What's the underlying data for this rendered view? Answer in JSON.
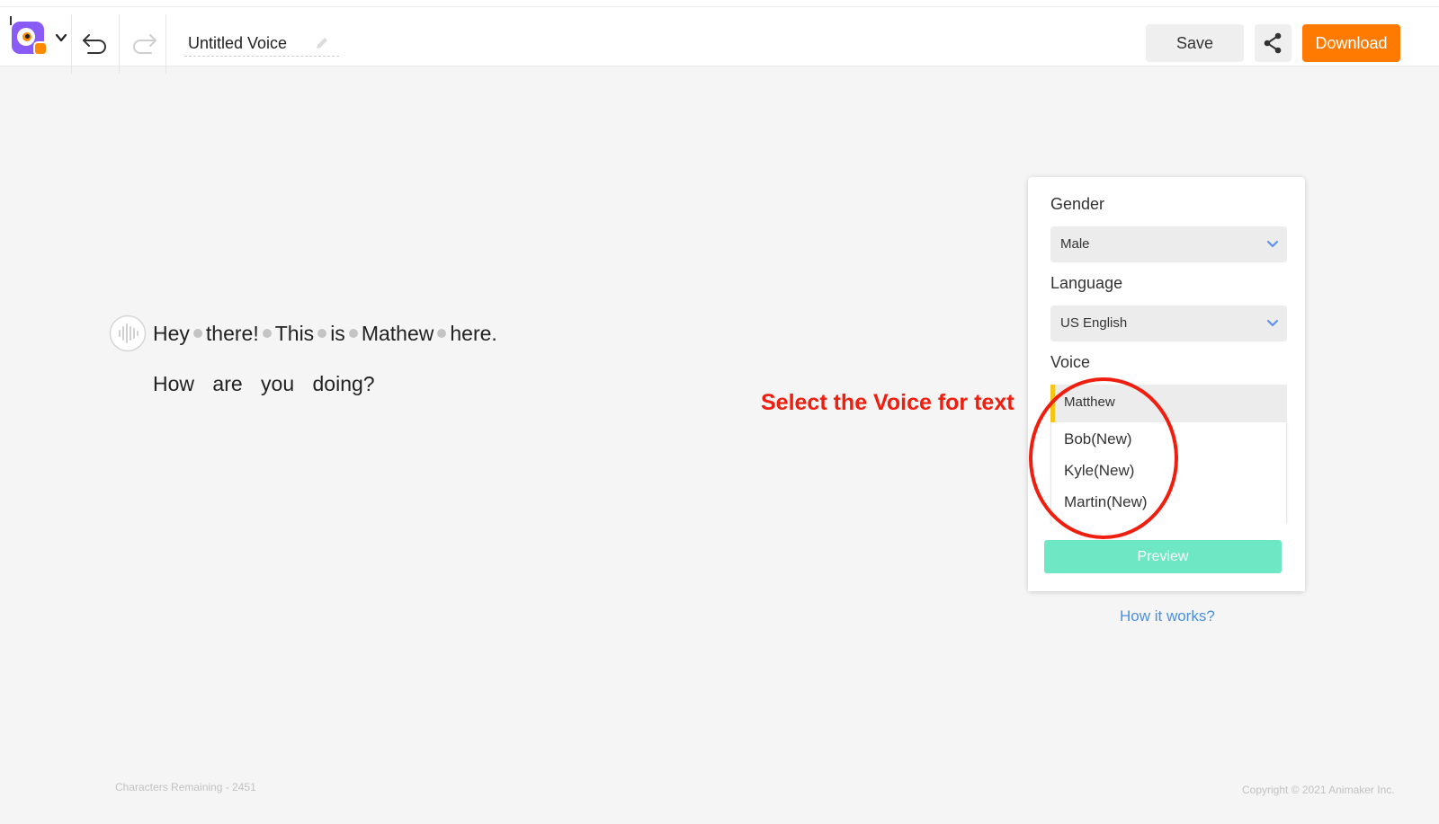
{
  "header": {
    "logo_icon": "animaker-voice-logo",
    "title": "Untitled Voice",
    "save_label": "Save",
    "share_icon": "share-icon",
    "download_label": "Download",
    "accent_color": "#ff7a00"
  },
  "editor": {
    "line1_words": [
      "Hey",
      "there!",
      "This",
      "is",
      "Mathew",
      "here."
    ],
    "line2": "How are you doing?"
  },
  "annotation": {
    "text": "Select the Voice for text",
    "color": "#f01e0e"
  },
  "voice_panel": {
    "gender_label": "Gender",
    "gender_value": "Male",
    "language_label": "Language",
    "language_value": "US English",
    "voice_label": "Voice",
    "voice_value": "Matthew",
    "voice_options": [
      "Bob(New)",
      "Kyle(New)",
      "Martin(New)"
    ],
    "preview_label": "Preview",
    "preview_color": "#6ee7c5"
  },
  "help_link": "How it works?",
  "footer": {
    "characters_remaining": "Characters Remaining - 2451",
    "copyright": "Copyright © 2021 Animaker Inc."
  }
}
